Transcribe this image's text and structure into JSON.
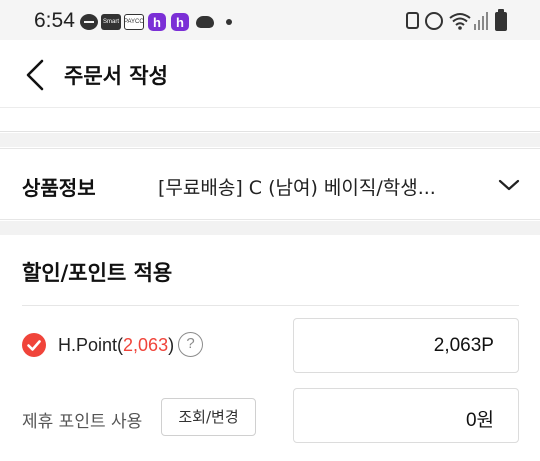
{
  "status_bar": {
    "time": "6:54",
    "left_icons": [
      "chat-icon",
      "smart-icon",
      "payco-icon",
      "h-app-icon",
      "h-app-icon",
      "cloud-icon",
      "dot-icon"
    ],
    "smart_label": "Smart",
    "payco_label": "PAYCO",
    "h_label": "h",
    "right_icons": [
      "lock-icon",
      "alarm-icon",
      "wifi-icon",
      "signal-icon",
      "battery-icon"
    ]
  },
  "header": {
    "title": "주문서 작성"
  },
  "product": {
    "label": "상품정보",
    "name": "[무료배송] C (남여) 베이직/학생..."
  },
  "discount": {
    "title": "할인/포인트 적용",
    "hpoint": {
      "label": "H.Point",
      "paren_open": "(",
      "available": "2,063",
      "paren_close": ")",
      "help": "?",
      "checked": true,
      "input_value": "2,063P"
    },
    "partner": {
      "label": "제휴 포인트 사용",
      "button_label": "조회/변경",
      "input_value": "0원"
    }
  },
  "colors": {
    "accent": "#f0443a",
    "band": "#f2f2f2",
    "status_bar": "#f5f5f5",
    "app_purple": "#7b2fd6"
  }
}
